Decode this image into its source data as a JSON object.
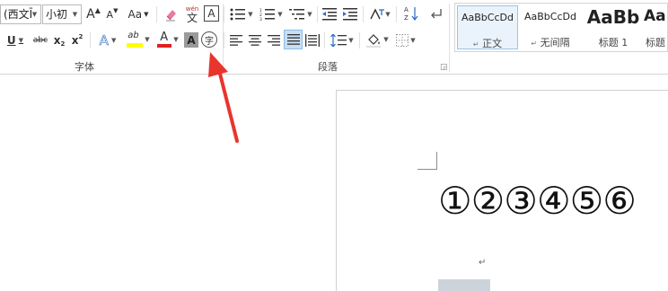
{
  "font": {
    "family_value": "(西文Ī",
    "size_value": "小初",
    "group_label": "字体"
  },
  "paragraph": {
    "group_label": "段落"
  },
  "buttons": {
    "grow_font": "A",
    "shrink_font": "A",
    "change_case": "Aa",
    "phonetic_top": "wén",
    "phonetic_bottom": "文",
    "char_border": "A",
    "bold_underline": "U",
    "strikethrough": "abc",
    "subscript": "x",
    "superscript": "x",
    "text_effect": "A",
    "highlight": "ab",
    "font_color": "A",
    "char_shading": "A",
    "enclose_char": "字"
  },
  "styles_gallery": [
    {
      "preview": "AaBbCcDd",
      "name": "正文",
      "mark": "↵"
    },
    {
      "preview": "AaBbCcDd",
      "name": "无间隔",
      "mark": "↵"
    },
    {
      "preview": "AaBb",
      "name": "标题 1",
      "mark": ""
    },
    {
      "preview": "AaB",
      "name": "标题",
      "mark": ""
    }
  ],
  "document": {
    "circled_numbers": "①②③④⑤⑥",
    "paragraph_mark": "↵"
  },
  "colors": {
    "highlight_yellow": "#ffff00",
    "font_color_red": "#e02020",
    "arrow_red": "#e8352e",
    "selected_style_bg": "#eaf3fb"
  }
}
